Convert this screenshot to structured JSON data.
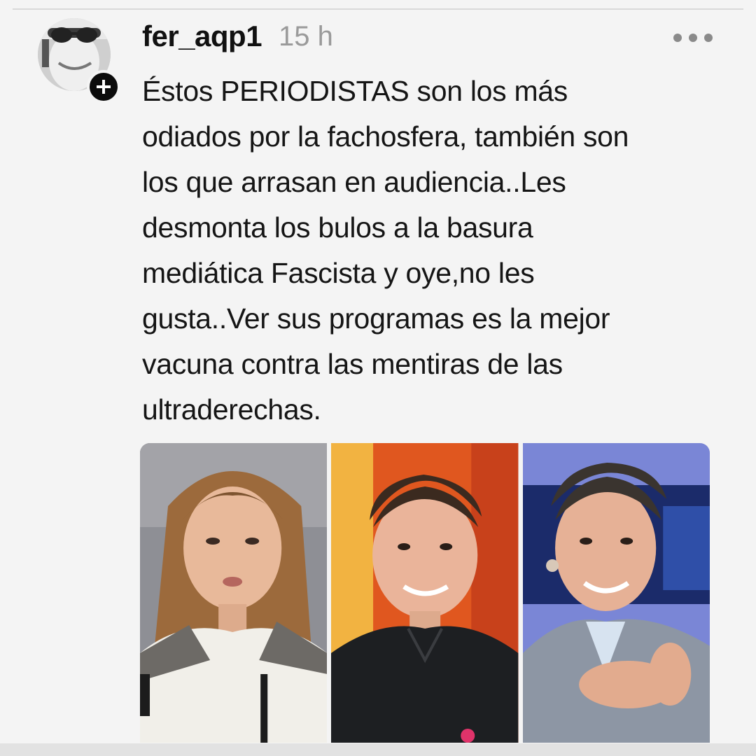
{
  "post": {
    "username": "fer_aqp1",
    "timestamp": "15 h",
    "text_lines": [
      "Éstos PERIODISTAS son los más",
      "odiados por la fachosfera, también son",
      "los que arrasan en audiencia..Les",
      "desmonta los bulos a la basura",
      "mediática Fascista y oye,no les",
      "gusta..Ver sus programas es la mejor",
      "vacuna contra las mentiras de las",
      "ultraderechas."
    ]
  },
  "icons": {
    "follow": "plus-icon",
    "more": "more-horizontal-icon"
  },
  "media": {
    "photos": [
      {
        "subject": "woman-portrait",
        "background": "#8e8f95"
      },
      {
        "subject": "man-portrait",
        "background": "#e0571f"
      },
      {
        "subject": "man-portrait-gesturing",
        "background": "#7a86d6"
      }
    ]
  },
  "colors": {
    "background": "#f4f4f4",
    "text": "#151515",
    "muted": "#9a9a9a"
  }
}
